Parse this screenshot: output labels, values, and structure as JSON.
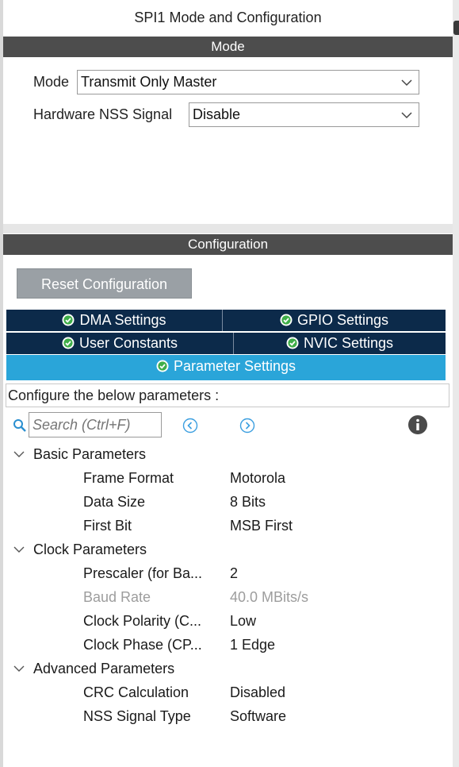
{
  "title": "SPI1 Mode and Configuration",
  "mode_section": {
    "header": "Mode",
    "mode_label": "Mode",
    "mode_value": "Transmit Only Master",
    "nss_label": "Hardware NSS Signal",
    "nss_value": "Disable"
  },
  "config_section": {
    "header": "Configuration",
    "reset_button": "Reset Configuration",
    "tabs": [
      {
        "label": "DMA Settings"
      },
      {
        "label": "GPIO Settings"
      },
      {
        "label": "User Constants"
      },
      {
        "label": "NVIC Settings"
      },
      {
        "label": "Parameter Settings",
        "active": true
      }
    ],
    "description": "Configure the below parameters :",
    "search_placeholder": "Search (Ctrl+F)"
  },
  "parameters": {
    "groups": [
      {
        "label": "Basic Parameters",
        "items": [
          {
            "name": "Frame Format",
            "value": "Motorola"
          },
          {
            "name": "Data Size",
            "value": "8 Bits"
          },
          {
            "name": "First Bit",
            "value": "MSB First"
          }
        ]
      },
      {
        "label": "Clock Parameters",
        "items": [
          {
            "name": "Prescaler (for Ba...",
            "value": "2"
          },
          {
            "name": "Baud Rate",
            "value": "40.0 MBits/s",
            "disabled": true
          },
          {
            "name": "Clock Polarity (C...",
            "value": "Low"
          },
          {
            "name": "Clock Phase (CP...",
            "value": "1 Edge"
          }
        ]
      },
      {
        "label": "Advanced Parameters",
        "items": [
          {
            "name": "CRC Calculation",
            "value": "Disabled"
          },
          {
            "name": "NSS Signal Type",
            "value": "Software"
          }
        ]
      }
    ]
  },
  "colors": {
    "section_bar": "#4d4d4d",
    "tab_dark": "#0c2a4a",
    "tab_active": "#2aa5d9",
    "reset_button": "#9aa0a5",
    "check_green": "#3fae49"
  }
}
